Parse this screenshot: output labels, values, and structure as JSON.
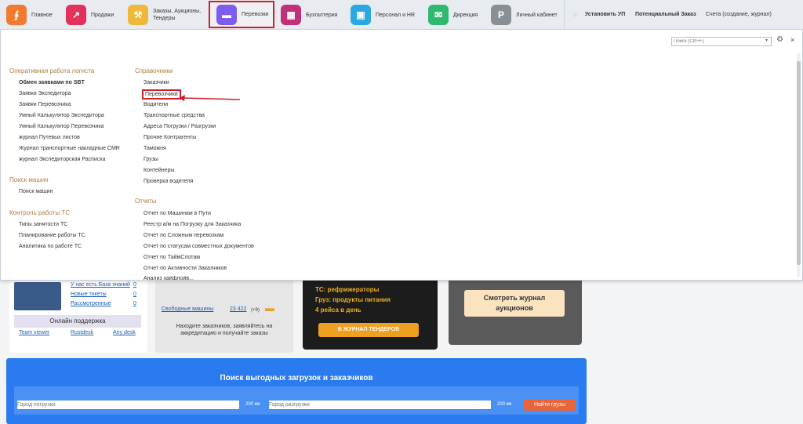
{
  "topnav": {
    "items": [
      {
        "label": "Главное",
        "color": "#f07a2e",
        "glyph": "⚙"
      },
      {
        "label": "Продажи",
        "color": "#e2315b",
        "glyph": "↗"
      },
      {
        "label": "Заказы, Аукционы, Тендеры",
        "color": "#f0b83a",
        "glyph": "⚒"
      },
      {
        "label": "Перевозки",
        "color": "#7d5cf0",
        "glyph": "■"
      },
      {
        "label": "Бухгалтерия",
        "color": "#c2307a",
        "glyph": "▦"
      },
      {
        "label": "Персонал и HR",
        "color": "#2aa9e0",
        "glyph": "▣"
      },
      {
        "label": "Дирекция",
        "color": "#2fb870",
        "glyph": "✉"
      },
      {
        "label": "Личный кабинет",
        "color": "#8a8f96",
        "glyph": "P"
      }
    ],
    "links": {
      "install": "Установить УП",
      "potential": "Потенциальный Заказ",
      "invoices": "Счета (создание, журнал)"
    },
    "highlight_color": "#d0202a"
  },
  "search": {
    "placeholder": "Поиск (Ctrl+F)"
  },
  "menu": {
    "col1": [
      {
        "title": "Оперативная работа логиста",
        "items": [
          "Обмен заявками по SBT",
          "Заявки Экспедитора",
          "Заявки Перевозчика",
          "Умный Калькулятор Экспедитора",
          "Умный Калькулятор Перевозчика",
          "журнал Путевых листов",
          "Журнал транспортные накладные CMR",
          "журнал Экспедиторская Расписка"
        ]
      },
      {
        "title": "Поиск машин",
        "items": [
          "Поиск машин"
        ]
      },
      {
        "title": "Контроль работы ТС",
        "items": [
          "Типы занятости ТС",
          "Планирование работы ТС",
          "Аналитика по работе ТС"
        ]
      }
    ],
    "col2": [
      {
        "title": "Справочники",
        "items": [
          "Заказчики",
          "Перевозчики",
          "Водители",
          "Транспортные средства",
          "Адреса Погрузки / Разгрузки",
          "Прочие Контрагенты",
          "Таможня",
          "Грузы",
          "Контейнеры",
          "Проверка водителя"
        ]
      },
      {
        "title": "Отчеты",
        "items": [
          "Отчет по Машинам в Пути",
          "Реестр а/м на Погрузку для Заказчика",
          "Отчет по Сложным перевозкам",
          "Отчет по статусам совместных документов",
          "Отчет по ТаймСлотам",
          "Отчет по Активности Заказчиков",
          "Анализ хайфлойв..."
        ]
      }
    ]
  },
  "bg": {
    "user_links": [
      {
        "label": "У нас есть База знаний",
        "count": "0"
      },
      {
        "label": "Новые тикеты",
        "count": "0"
      },
      {
        "label": "Рассмотренные",
        "count": "0"
      }
    ],
    "support_title": "Онлайн поддержка",
    "support_links": [
      "Team viewer",
      "Rustdesk",
      "Any desk"
    ],
    "free_machines_label": "Свободные машины",
    "free_machines_count": "23 422",
    "free_machines_badge": "(+9)",
    "hint": "Находите заказчиков, заявляйтесь на аккредитацию и получайте заказы",
    "promo_lines": [
      "ТС: рефрижераторы",
      "Груз: продукты питания",
      "4 рейса в день"
    ],
    "promo_btn": "В ЖУРНАЛ ТЕНДЕРОВ",
    "auction_btn": "Смотреть журнал аукционов",
    "search_title": "Поиск выгодных загрузок и заказчиков",
    "from_placeholder": "Город погрузки",
    "to_placeholder": "Город разгрузки",
    "km": "200 км",
    "find_btn": "Найти грузы"
  }
}
